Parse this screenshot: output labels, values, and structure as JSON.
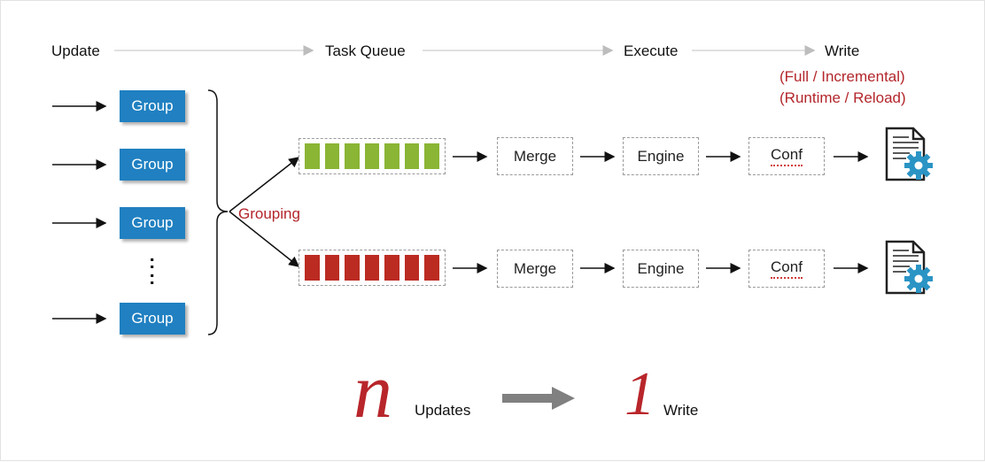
{
  "header": {
    "update": "Update",
    "task_queue": "Task Queue",
    "execute": "Execute",
    "write": "Write",
    "write_note_1": "(Full / Incremental)",
    "write_note_2": "(Runtime / Reload)"
  },
  "groups": [
    "Group",
    "Group",
    "Group",
    "Group"
  ],
  "ellipsis": ":",
  "grouping_label": "Grouping",
  "pipeline": {
    "merge": "Merge",
    "engine": "Engine",
    "conf": "Conf"
  },
  "summary": {
    "n_glyph": "n",
    "updates": "Updates",
    "one_glyph": "1",
    "write": "Write"
  },
  "colors": {
    "group_blue": "#2080c1",
    "queue_green": "#8ab535",
    "queue_red": "#bb2b22",
    "accent_red": "#b3262b",
    "doc_teal": "#2a94c4"
  },
  "icons": [
    "document-gear-icon",
    "document-gear-icon"
  ]
}
